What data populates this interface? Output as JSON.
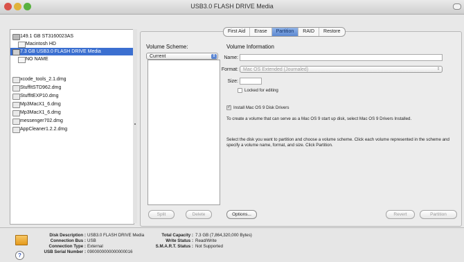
{
  "window": {
    "title": "USB3.0 FLASH DRIVE Media"
  },
  "sidebar": {
    "items": [
      {
        "label": "149.1 GB ST3160023AS",
        "icon": "hard-disk-icon"
      },
      {
        "label": "Macintosh HD",
        "icon": "volume-icon"
      },
      {
        "label": "7.3 GB USB3.0 FLASH DRIVE Media",
        "icon": "usb-drive-icon"
      },
      {
        "label": "NO NAME",
        "icon": "volume-icon"
      },
      {
        "label": "xcode_tools_2.1.dmg",
        "icon": "disk-image-icon"
      },
      {
        "label": "StuffItSTD962.dmg",
        "icon": "disk-image-icon"
      },
      {
        "label": "StuffItEXP10.dmg",
        "icon": "disk-image-icon"
      },
      {
        "label": "Mp3MacX1_6.dmg",
        "icon": "disk-image-icon"
      },
      {
        "label": "Mp3MacX1_6.dmg",
        "icon": "disk-image-icon"
      },
      {
        "label": "messenger702.dmg",
        "icon": "disk-image-icon"
      },
      {
        "label": "AppCleaner1.2.2.dmg",
        "icon": "disk-image-icon"
      }
    ]
  },
  "tabs": [
    "First Aid",
    "Erase",
    "Partition",
    "RAID",
    "Restore"
  ],
  "active_tab": "Partition",
  "volume_scheme": {
    "title": "Volume Scheme:",
    "selected": "Current"
  },
  "volume_info": {
    "title": "Volume Information",
    "name_label": "Name:",
    "name_value": "",
    "format_label": "Format:",
    "format_value": "Mac OS Extended (Journaled)",
    "size_label": "Size:",
    "size_value": "",
    "locked_label": "Locked for editing",
    "install_label": "Install Mac OS 9 Disk Drivers",
    "install_checked": true,
    "os9_hint": "To create a volume that can serve as a Mac OS 9 start up disk, select Mac OS 9 Drivers Installed.",
    "instructions": "Select the disk you want to partition and choose a volume scheme. Click each volume represented in the scheme and specify a volume name, format, and size. Click Partition."
  },
  "buttons": {
    "split": "Split",
    "delete": "Delete",
    "options": "Options...",
    "revert": "Revert",
    "partition": "Partition"
  },
  "status": {
    "disk_description_label": "Disk Description :",
    "disk_description": "USB3.0 FLASH DRIVE Media",
    "connection_bus_label": "Connection Bus :",
    "connection_bus": "USB",
    "connection_type_label": "Connection Type :",
    "connection_type": "External",
    "serial_label": "USB Serial Number :",
    "serial": "0900000000000000016",
    "total_capacity_label": "Total Capacity :",
    "total_capacity": "7.3 GB (7,864,320,000 Bytes)",
    "write_status_label": "Write Status :",
    "write_status": "Read/Write",
    "smart_label": "S.M.A.R.T. Status :",
    "smart": "Not Supported"
  },
  "colors": {
    "selection": "#3b6fd0",
    "tab_active": "#5d89d2"
  }
}
